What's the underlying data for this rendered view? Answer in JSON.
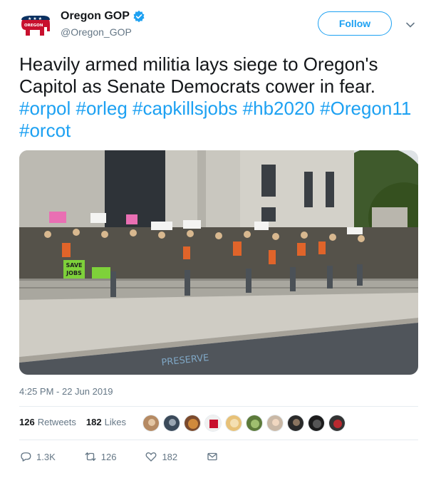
{
  "author": {
    "name": "Oregon GOP",
    "handle": "@Oregon_GOP",
    "avatar_label": "OREGON",
    "verified": true
  },
  "follow_label": "Follow",
  "tweet": {
    "text": "Heavily armed militia lays siege to Oregon's Capitol as Senate Democrats cower in fear.",
    "hashtags": [
      "#orpol",
      "#orleg",
      "#capkillsjobs",
      "#hb2020",
      "#Oregon11",
      "#orcot"
    ]
  },
  "photo": {
    "signs": [
      "SAVE",
      "JOBS"
    ]
  },
  "timestamp": "4:25 PM - 22 Jun 2019",
  "stats": {
    "retweets_count": "126",
    "retweets_label": "Retweets",
    "likes_count": "182",
    "likes_label": "Likes"
  },
  "actions": {
    "reply_count": "1.3K",
    "retweet_count": "126",
    "like_count": "182"
  },
  "colors": {
    "accent": "#1da1f2",
    "muted": "#657786",
    "text": "#14171a",
    "divider": "#e6ecf0"
  }
}
